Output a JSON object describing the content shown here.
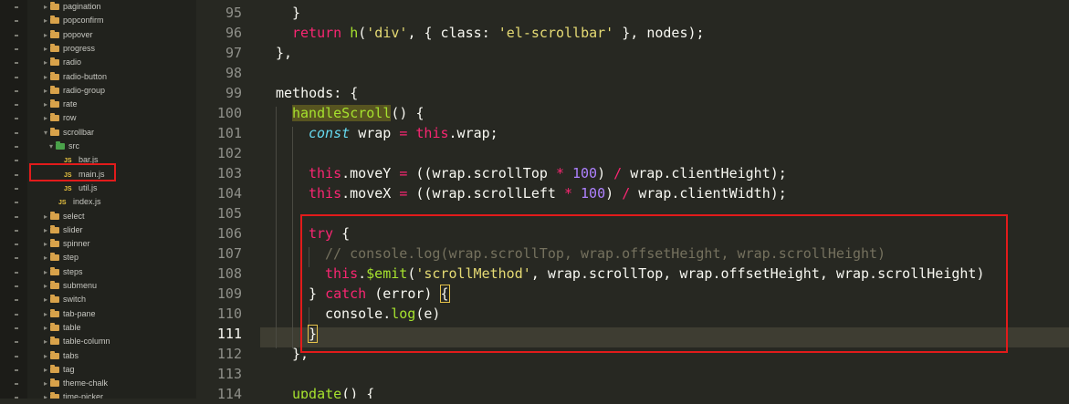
{
  "sidebar": {
    "items": [
      {
        "label": "pagination",
        "kind": "folder",
        "state": "collapsed"
      },
      {
        "label": "popconfirm",
        "kind": "folder",
        "state": "collapsed"
      },
      {
        "label": "popover",
        "kind": "folder",
        "state": "collapsed"
      },
      {
        "label": "progress",
        "kind": "folder",
        "state": "collapsed"
      },
      {
        "label": "radio",
        "kind": "folder",
        "state": "collapsed"
      },
      {
        "label": "radio-button",
        "kind": "folder",
        "state": "collapsed"
      },
      {
        "label": "radio-group",
        "kind": "folder",
        "state": "collapsed"
      },
      {
        "label": "rate",
        "kind": "folder",
        "state": "collapsed"
      },
      {
        "label": "row",
        "kind": "folder",
        "state": "collapsed"
      },
      {
        "label": "scrollbar",
        "kind": "folder",
        "state": "expanded"
      },
      {
        "label": "src",
        "kind": "folder",
        "state": "expanded"
      },
      {
        "label": "bar.js",
        "kind": "file",
        "icon": "JS"
      },
      {
        "label": "main.js",
        "kind": "file",
        "icon": "JS",
        "selected": true
      },
      {
        "label": "util.js",
        "kind": "file",
        "icon": "JS"
      },
      {
        "label": "index.js",
        "kind": "file",
        "icon": "JS"
      },
      {
        "label": "select",
        "kind": "folder",
        "state": "collapsed"
      },
      {
        "label": "slider",
        "kind": "folder",
        "state": "collapsed"
      },
      {
        "label": "spinner",
        "kind": "folder",
        "state": "collapsed"
      },
      {
        "label": "step",
        "kind": "folder",
        "state": "collapsed"
      },
      {
        "label": "steps",
        "kind": "folder",
        "state": "collapsed"
      },
      {
        "label": "submenu",
        "kind": "folder",
        "state": "collapsed"
      },
      {
        "label": "switch",
        "kind": "folder",
        "state": "collapsed"
      },
      {
        "label": "tab-pane",
        "kind": "folder",
        "state": "collapsed"
      },
      {
        "label": "table",
        "kind": "folder",
        "state": "collapsed"
      },
      {
        "label": "table-column",
        "kind": "folder",
        "state": "collapsed"
      },
      {
        "label": "tabs",
        "kind": "folder",
        "state": "collapsed"
      },
      {
        "label": "tag",
        "kind": "folder",
        "state": "collapsed"
      },
      {
        "label": "theme-chalk",
        "kind": "folder",
        "state": "collapsed"
      },
      {
        "label": "time-picker",
        "kind": "folder",
        "state": "collapsed"
      }
    ]
  },
  "editor": {
    "current_line": "111",
    "lines": [
      {
        "num": "95",
        "tokens": [
          [
            "br1",
            "}"
          ]
        ]
      },
      {
        "num": "96",
        "tokens": [
          [
            "kw",
            "return "
          ],
          [
            "fn",
            "h"
          ],
          [
            "br1",
            "("
          ],
          [
            "str",
            "'div'"
          ],
          [
            "br1",
            ", { class: "
          ],
          [
            "str",
            "'el-scrollbar'"
          ],
          [
            "br1",
            " }, nodes);"
          ]
        ]
      },
      {
        "num": "97",
        "tokens": [
          [
            "br1",
            "},"
          ]
        ]
      },
      {
        "num": "98",
        "tokens": []
      },
      {
        "num": "99",
        "tokens": [
          [
            "br1",
            "methods: {"
          ]
        ]
      },
      {
        "num": "100",
        "tokens": [
          [
            "fnhl",
            "handleScroll"
          ],
          [
            "br1",
            "() {"
          ]
        ]
      },
      {
        "num": "101",
        "tokens": [
          [
            "it",
            "const "
          ],
          [
            "br1",
            "wrap "
          ],
          [
            "kw",
            "= "
          ],
          [
            "kw",
            "this"
          ],
          [
            "br1",
            ".wrap;"
          ]
        ]
      },
      {
        "num": "102",
        "tokens": []
      },
      {
        "num": "103",
        "tokens": [
          [
            "kw",
            "this"
          ],
          [
            "br1",
            ".moveY "
          ],
          [
            "kw",
            "= "
          ],
          [
            "br1",
            "((wrap.scrollTop "
          ],
          [
            "kw",
            "* "
          ],
          [
            "num",
            "100"
          ],
          [
            "br1",
            ") "
          ],
          [
            "kw",
            "/ "
          ],
          [
            "br1",
            "wrap.clientHeight);"
          ]
        ]
      },
      {
        "num": "104",
        "tokens": [
          [
            "kw",
            "this"
          ],
          [
            "br1",
            ".moveX "
          ],
          [
            "kw",
            "= "
          ],
          [
            "br1",
            "((wrap.scrollLeft "
          ],
          [
            "kw",
            "* "
          ],
          [
            "num",
            "100"
          ],
          [
            "br1",
            ") "
          ],
          [
            "kw",
            "/ "
          ],
          [
            "br1",
            "wrap.clientWidth);"
          ]
        ]
      },
      {
        "num": "105",
        "tokens": []
      },
      {
        "num": "106",
        "tokens": [
          [
            "kw",
            "try "
          ],
          [
            "br1",
            "{"
          ]
        ]
      },
      {
        "num": "107",
        "tokens": [
          [
            "cm",
            "// console.log(wrap.scrollTop, wrap.offsetHeight, wrap.scrollHeight)"
          ]
        ]
      },
      {
        "num": "108",
        "tokens": [
          [
            "kw",
            "this"
          ],
          [
            "br1",
            "."
          ],
          [
            "fn",
            "$emit"
          ],
          [
            "br1",
            "("
          ],
          [
            "str",
            "'scrollMethod'"
          ],
          [
            "br1",
            ", wrap.scrollTop, wrap.offsetHeight, wrap.scrollHeight)"
          ]
        ]
      },
      {
        "num": "109",
        "tokens": [
          [
            "br1",
            "} "
          ],
          [
            "kw",
            "catch "
          ],
          [
            "br1",
            "(error) "
          ],
          [
            "brm",
            "{"
          ]
        ]
      },
      {
        "num": "110",
        "tokens": [
          [
            "br1",
            "console."
          ],
          [
            "fn",
            "log"
          ],
          [
            "br1",
            "(e)"
          ]
        ]
      },
      {
        "num": "111",
        "tokens": [
          [
            "brm",
            "}"
          ]
        ]
      },
      {
        "num": "112",
        "tokens": [
          [
            "br1",
            "},"
          ]
        ]
      },
      {
        "num": "113",
        "tokens": []
      },
      {
        "num": "114",
        "tokens": [
          [
            "fn",
            "update"
          ],
          [
            "br1",
            "() {"
          ]
        ]
      }
    ]
  },
  "colors": {
    "background": "#272822",
    "sidebar_bg": "#21221d",
    "highlight_box": "#e21b1b",
    "folder": "#d8a24a",
    "js_icon": "#e8c341"
  }
}
